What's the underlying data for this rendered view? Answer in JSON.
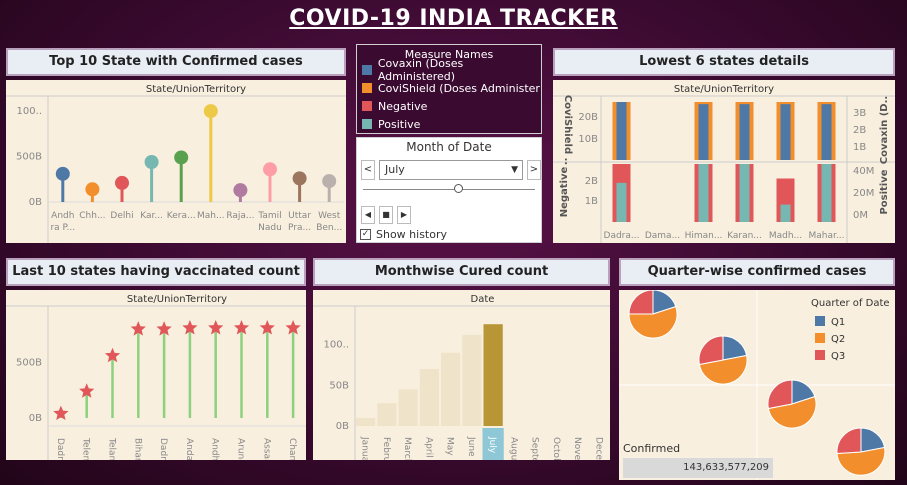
{
  "title": "COVID-19 INDIA TRACKER",
  "colors": {
    "blue": "#4e79a7",
    "orange": "#f28e2b",
    "red": "#e15759",
    "teal": "#76b7b2",
    "green": "#59a14f",
    "yellow": "#edc948",
    "purple": "#b07aa1",
    "pink": "#ff9da7",
    "brown": "#9c755f",
    "grey": "#bab0ac",
    "gold": "#b89535",
    "star": "#e15759",
    "stem": "#8cd17d",
    "highlight": "#8ec8d6"
  },
  "legend": {
    "title": "Measure Names",
    "items": [
      {
        "label": "Covaxin (Doses Administered)",
        "color": "#4e79a7"
      },
      {
        "label": "CoviShield (Doses Administer",
        "color": "#f28e2b"
      },
      {
        "label": "Negative",
        "color": "#e15759"
      },
      {
        "label": "Positive",
        "color": "#76b7b2"
      }
    ]
  },
  "filter": {
    "title": "Month of Date",
    "selected": "July",
    "show_history": "Show history",
    "prev": "<",
    "next": ">",
    "play": "▶",
    "stop": "■"
  },
  "panels": {
    "top10": {
      "title": "Top 10 State with Confirmed cases",
      "header": "State/UnionTerritory"
    },
    "lowest6": {
      "title": "Lowest 6 states details",
      "header": "State/UnionTerritory",
      "ylabel_top_left": "CoviShield ..",
      "ylabel_top_right": "Covaxin (D..",
      "ylabel_bot_left": "Negative",
      "ylabel_bot_right": "Positive"
    },
    "last10": {
      "title": "Last 10  states having vaccinated count",
      "header": "State/UnionTerritory"
    },
    "monthwise": {
      "title": "Monthwise Cured count",
      "header": "Date"
    },
    "quarter": {
      "title": "Quarter-wise confirmed cases",
      "legend_title": "Quarter of Date",
      "confirmed_label": "Confirmed",
      "confirmed_value": "143,633,577,209"
    }
  },
  "chart_data": [
    {
      "type": "lollipop",
      "id": "top10",
      "categories": [
        "Andh ra P...",
        "Chh...",
        "Delhi",
        "Kar...",
        "Kera...",
        "Mah...",
        "Raja...",
        "Tamil Nadu",
        "Uttar Pra...",
        "West Ben..."
      ],
      "values": [
        310,
        140,
        210,
        440,
        490,
        1000,
        130,
        360,
        260,
        230
      ],
      "colors": [
        "#4e79a7",
        "#f28e2b",
        "#e15759",
        "#76b7b2",
        "#59a14f",
        "#edc948",
        "#b07aa1",
        "#ff9da7",
        "#9c755f",
        "#bab0ac"
      ],
      "yticks": [
        {
          "v": 0,
          "label": "0B"
        },
        {
          "v": 500,
          "label": "500B"
        },
        {
          "v": 1000,
          "label": "100.."
        }
      ],
      "ylim": [
        0,
        1100
      ]
    },
    {
      "type": "bar",
      "id": "lowest6_top",
      "categories": [
        "Dadra...",
        "Dama...",
        "Himan...",
        "Karan...",
        "Madh...",
        "Mahar..."
      ],
      "series": [
        {
          "name": "Covaxin (Doses Administered)",
          "values": [
            2.7,
            0,
            2.6,
            2.6,
            2.6,
            2.6
          ]
        },
        {
          "name": "CoviShield (Doses Administer",
          "values": [
            25,
            0,
            25,
            25,
            25,
            25
          ]
        }
      ],
      "left_ticks": [
        "20B",
        "10B"
      ],
      "right_ticks": [
        "3B",
        "2B",
        "1B"
      ]
    },
    {
      "type": "bar",
      "id": "lowest6_bottom",
      "categories": [
        "Dadra...",
        "Dama...",
        "Himan...",
        "Karan...",
        "Madh...",
        "Mahar..."
      ],
      "series": [
        {
          "name": "Negative",
          "values": [
            2.8,
            0,
            2.8,
            2.8,
            2.1,
            2.8
          ]
        },
        {
          "name": "Positive",
          "values": [
            27,
            0,
            40,
            40,
            12,
            40
          ]
        }
      ],
      "left_ticks": [
        "2B",
        "1B"
      ],
      "right_ticks": [
        "40M",
        "20M",
        "0M"
      ]
    },
    {
      "type": "lollipop",
      "id": "last10",
      "categories": [
        "Dadra...",
        "Teleng...",
        "Telang...",
        "Bihar",
        "Dadra...",
        "Andam...",
        "Andhr...",
        "Arunac...",
        "Assam",
        "Chandi..."
      ],
      "values": [
        40,
        240,
        560,
        800,
        800,
        810,
        810,
        810,
        810,
        810
      ],
      "yticks": [
        {
          "v": 0,
          "label": "0B"
        },
        {
          "v": 500,
          "label": "500B"
        }
      ],
      "ylim": [
        0,
        900
      ]
    },
    {
      "type": "bar",
      "id": "monthwise",
      "categories": [
        "January",
        "Februa...",
        "March",
        "April",
        "May",
        "June",
        "July",
        "August",
        "Septe...",
        "October",
        "Novem...",
        "Decem..."
      ],
      "values": [
        10,
        28,
        45,
        70,
        90,
        112,
        125,
        0,
        0,
        0,
        0,
        0
      ],
      "selected": "July",
      "yticks": [
        {
          "v": 0,
          "label": "0B"
        },
        {
          "v": 50,
          "label": "50B"
        },
        {
          "v": 100,
          "label": "100.."
        }
      ],
      "ylim": [
        0,
        140
      ]
    },
    {
      "type": "pie",
      "id": "quarter",
      "series_names": [
        "Q1",
        "Q2",
        "Q3"
      ],
      "pies": [
        [
          0.2,
          0.55,
          0.25
        ],
        [
          0.22,
          0.5,
          0.28
        ],
        [
          0.2,
          0.52,
          0.28
        ],
        [
          0.22,
          0.52,
          0.26
        ]
      ],
      "colors": [
        "#4e79a7",
        "#f28e2b",
        "#e15759"
      ]
    }
  ]
}
